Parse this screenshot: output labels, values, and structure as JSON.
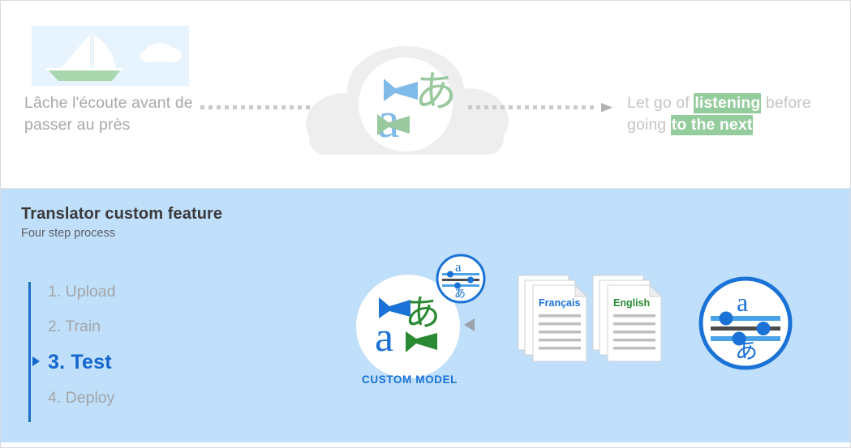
{
  "top_banner": {
    "source_image_alt": "sailboat-photo",
    "source_text": "Lâche l'écoute avant de passer au près",
    "flow_arrow_left": "dotted-arrow-right-icon",
    "service_icon": "translator-cloud-icon",
    "flow_arrow_right": "dotted-arrow-right-icon",
    "target_text": {
      "part1": "Let go of ",
      "highlight1": "listening",
      "part2": " before going ",
      "highlight2": "to the next"
    },
    "highlight_color": "#95cc9d"
  },
  "panel": {
    "title": "Translator custom feature",
    "subtitle": "Four step process",
    "accent_color": "#1266cc",
    "background_color": "#bfdffb",
    "steps": [
      {
        "label": "1. Upload",
        "active": false
      },
      {
        "label": "2. Train",
        "active": false
      },
      {
        "label": "3. Test",
        "active": true
      },
      {
        "label": "4. Deploy",
        "active": false
      }
    ],
    "graphics": {
      "custom_model": {
        "icon": "translator-custom-model-icon",
        "badge_icon": "tune-sliders-badge-icon",
        "label": "CUSTOM MODEL",
        "pointer_icon": "triangle-left-icon"
      },
      "documents": {
        "stack_left_label": "Français",
        "stack_left_color": "#1a72d6",
        "stack_right_label": "English",
        "stack_right_color": "#2a8a33",
        "icon": "document-stack-icon"
      },
      "test_circle": {
        "icon": "tune-sliders-circle-icon",
        "top_glyph": "a",
        "bottom_glyph": "あ"
      }
    }
  }
}
